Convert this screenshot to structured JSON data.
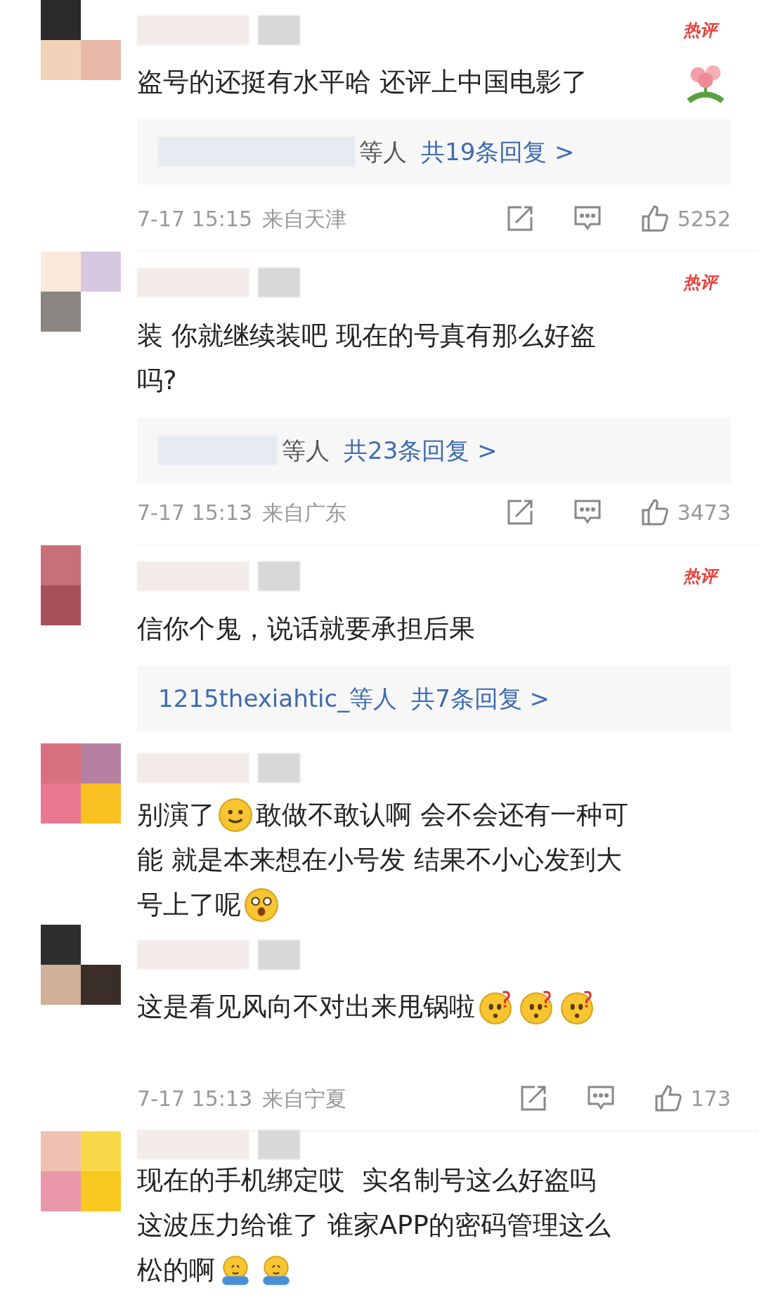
{
  "comments": [
    {
      "hot_label": "热评",
      "lines": [
        [
          {
            "kind": "text",
            "text": "盗号的还挺有水平哈 还评上中国电影了"
          },
          {
            "kind": "flower"
          }
        ]
      ],
      "replies": {
        "names": "等人",
        "count": "共19条回复 >"
      },
      "time": "7-17 15:15",
      "location": "来自天津",
      "likes": "5252"
    },
    {
      "hot_label": "热评",
      "lines": [
        [
          {
            "kind": "text",
            "text": "装 你就继续装吧 现在的号真有那么好盗"
          }
        ],
        [
          {
            "kind": "text",
            "text": "吗?"
          }
        ]
      ],
      "replies": {
        "names": "等人",
        "count": "共23条回复 >"
      },
      "time": "7-17 15:13",
      "location": "来自广东",
      "likes": "3473"
    },
    {
      "hot_label": "热评",
      "lines": [
        [
          {
            "kind": "text",
            "text": "信你个鬼，说话就要承担后果"
          }
        ]
      ],
      "replies": {
        "names": "1215thexiahtic_等人",
        "count": "共7条回复 >"
      }
    },
    {
      "lines": [
        [
          {
            "kind": "text",
            "text": "别演了"
          },
          {
            "kind": "smile"
          },
          {
            "kind": "text",
            "text": "敢做不敢认啊 会不会还有一种可"
          }
        ],
        [
          {
            "kind": "text",
            "text": "能 就是本来想在小号发 结果不小心发到大"
          }
        ],
        [
          {
            "kind": "text",
            "text": "号上了呢"
          },
          {
            "kind": "surprised"
          }
        ]
      ]
    },
    {
      "lines": [
        [
          {
            "kind": "text",
            "text": "这是看见风向不对出来甩锅啦"
          },
          {
            "kind": "puzzled"
          },
          {
            "kind": "puzzled"
          },
          {
            "kind": "puzzled"
          }
        ]
      ],
      "time": "7-17 15:13",
      "location": "来自宁夏",
      "likes": "173"
    },
    {
      "lines": [
        [
          {
            "kind": "text",
            "text": "现在的手机绑定哎  实名制号这么好盗吗"
          }
        ],
        [
          {
            "kind": "text",
            "text": "这波压力给谁了 谁家APP的密码管理这么"
          }
        ],
        [
          {
            "kind": "text",
            "text": "松的啊"
          },
          {
            "kind": "hug"
          },
          {
            "kind": "hug"
          }
        ]
      ]
    }
  ]
}
